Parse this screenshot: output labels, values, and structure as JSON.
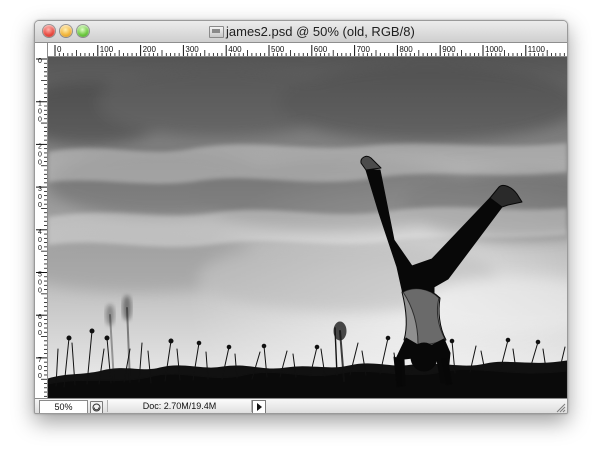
{
  "window": {
    "title": "james2.psd @ 50% (old, RGB/8)",
    "controls": {
      "close": "close",
      "minimize": "minimize",
      "zoom": "zoom"
    }
  },
  "rulers": {
    "horizontal_ticks": [
      "0",
      "100",
      "200",
      "300",
      "400",
      "500",
      "600",
      "700",
      "800",
      "900",
      "1000",
      "1100"
    ],
    "vertical_ticks": [
      "0",
      "100",
      "200",
      "300",
      "400",
      "500",
      "600",
      "700"
    ]
  },
  "status_bar": {
    "zoom": "50%",
    "doc_info": "Doc: 2.70M/19.4M"
  },
  "icons": {
    "document_proxy": "psd-document-icon",
    "preview": "preview-icon",
    "status_menu": "triangle-right-icon",
    "resize": "resize-grip-icon"
  },
  "colors": {
    "title_bar": "#d6d6d6",
    "canvas_bg": "#767676",
    "close": "#e8493f",
    "minimize": "#f2b53a",
    "zoom": "#6cc83f"
  }
}
